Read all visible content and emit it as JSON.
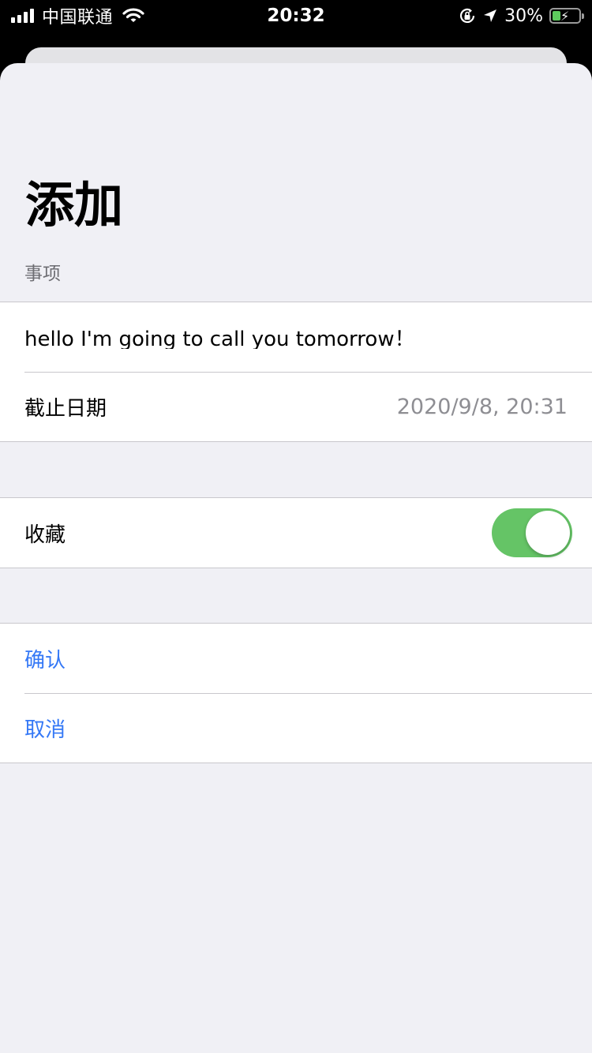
{
  "status_bar": {
    "carrier": "中国联通",
    "time": "20:32",
    "battery_percent": "30%",
    "battery_level": 0.3,
    "icons": [
      "signal-icon",
      "wifi-icon",
      "orientation-lock-icon",
      "location-arrow-icon",
      "battery-charging-icon"
    ]
  },
  "sheet": {
    "title": "添加",
    "section_header": "事项",
    "todo_input_value": "hello I'm going to call you tomorrow！",
    "due_date_label": "截止日期",
    "due_date_value": "2020/9/8, 20:31",
    "favorite_label": "收藏",
    "favorite_on": true,
    "confirm_label": "确认",
    "cancel_label": "取消"
  },
  "colors": {
    "accent": "#3478f6",
    "toggle_on": "#65c466",
    "background": "#f0f0f5",
    "secondary_text": "#8e8e93"
  }
}
